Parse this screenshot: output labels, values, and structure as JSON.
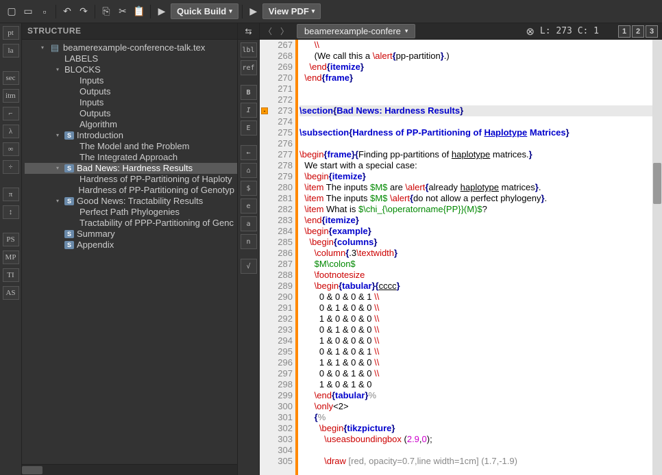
{
  "toolbar": {
    "quick_build": "Quick Build",
    "view_pdf": "View PDF"
  },
  "left_gutter": [
    "pt",
    "la",
    "sec",
    "itm",
    "⌐",
    "λ",
    "∞",
    "÷",
    "π",
    "↕",
    "PS",
    "MP",
    "TI",
    "AS"
  ],
  "mid_gutter": [
    "lbl",
    "ref",
    "B",
    "I",
    "E",
    "←",
    "⌂",
    "$",
    "e",
    "a",
    "n",
    "√"
  ],
  "structure": {
    "title": "STRUCTURE",
    "tree": [
      {
        "d": 0,
        "t": "▾",
        "i": "file",
        "l": "beamerexample-conference-talk.tex"
      },
      {
        "d": 1,
        "t": "",
        "i": "",
        "l": "LABELS"
      },
      {
        "d": 1,
        "t": "▾",
        "i": "",
        "l": "BLOCKS"
      },
      {
        "d": 2,
        "t": "",
        "i": "",
        "l": "Inputs"
      },
      {
        "d": 2,
        "t": "",
        "i": "",
        "l": "Outputs"
      },
      {
        "d": 2,
        "t": "",
        "i": "",
        "l": "Inputs"
      },
      {
        "d": 2,
        "t": "",
        "i": "",
        "l": "Outputs"
      },
      {
        "d": 2,
        "t": "",
        "i": "",
        "l": "Algorithm"
      },
      {
        "d": 1,
        "t": "▾",
        "i": "s",
        "l": "Introduction"
      },
      {
        "d": 2,
        "t": "",
        "i": "",
        "l": "The Model and the Problem"
      },
      {
        "d": 2,
        "t": "",
        "i": "",
        "l": "The Integrated Approach"
      },
      {
        "d": 1,
        "t": "▾",
        "i": "s",
        "l": "Bad News: Hardness Results",
        "sel": true
      },
      {
        "d": 2,
        "t": "",
        "i": "",
        "l": "Hardness of PP-Partitioning of Haploty"
      },
      {
        "d": 2,
        "t": "",
        "i": "",
        "l": "Hardness of PP-Partitioning of Genotyp"
      },
      {
        "d": 1,
        "t": "▾",
        "i": "s",
        "l": "Good News: Tractability Results"
      },
      {
        "d": 2,
        "t": "",
        "i": "",
        "l": "Perfect Path Phylogenies"
      },
      {
        "d": 2,
        "t": "",
        "i": "",
        "l": "Tractability of PPP-Partitioning of Genc"
      },
      {
        "d": 1,
        "t": "",
        "i": "s",
        "l": "Summary"
      },
      {
        "d": 1,
        "t": "",
        "i": "s",
        "l": "Appendix"
      }
    ]
  },
  "editor": {
    "tab": "beamerexample-confere",
    "pos": "L: 273 C: 1",
    "squares": [
      "1",
      "2",
      "3"
    ],
    "first_line": 267,
    "fold_at": 273,
    "highlight": 273,
    "lines": [
      [
        [
          "      ",
          "p"
        ],
        [
          "\\\\",
          "cmd"
        ]
      ],
      [
        [
          "      (We call this a ",
          "p"
        ],
        [
          "\\alert",
          "cmd"
        ],
        [
          "{",
          "br"
        ],
        [
          "pp-partition",
          "p"
        ],
        [
          "}",
          "br"
        ],
        [
          ".)",
          "p"
        ]
      ],
      [
        [
          "    ",
          "p"
        ],
        [
          "\\end",
          "cmd"
        ],
        [
          "{",
          "br"
        ],
        [
          "itemize",
          "sec"
        ],
        [
          "}",
          "br"
        ]
      ],
      [
        [
          "  ",
          "p"
        ],
        [
          "\\end",
          "cmd"
        ],
        [
          "{",
          "br"
        ],
        [
          "frame",
          "sec"
        ],
        [
          "}",
          "br"
        ]
      ],
      [
        [
          "",
          "p"
        ]
      ],
      [
        [
          "",
          "p"
        ]
      ],
      [
        [
          "\\section",
          "sec"
        ],
        [
          "{",
          "br"
        ],
        [
          "Bad News: Hardness Results",
          "sec"
        ],
        [
          "}",
          "br"
        ]
      ],
      [
        [
          "",
          "p"
        ]
      ],
      [
        [
          "\\subsection",
          "sec"
        ],
        [
          "{",
          "br"
        ],
        [
          "Hardness of PP-Partitioning of ",
          "sec"
        ],
        [
          "Haplotype",
          "secu"
        ],
        [
          " Matrices",
          "sec"
        ],
        [
          "}",
          "br"
        ]
      ],
      [
        [
          "",
          "p"
        ]
      ],
      [
        [
          "\\begin",
          "cmd"
        ],
        [
          "{",
          "br"
        ],
        [
          "frame",
          "sec"
        ],
        [
          "}{",
          "br"
        ],
        [
          "Finding pp-partitions of ",
          "p"
        ],
        [
          "haplotype",
          "u"
        ],
        [
          " matrices.",
          "p"
        ],
        [
          "}",
          "br"
        ]
      ],
      [
        [
          "  We start with a special case:",
          "p"
        ]
      ],
      [
        [
          "  ",
          "p"
        ],
        [
          "\\begin",
          "cmd"
        ],
        [
          "{",
          "br"
        ],
        [
          "itemize",
          "sec"
        ],
        [
          "}",
          "br"
        ]
      ],
      [
        [
          "  ",
          "p"
        ],
        [
          "\\item",
          "cmd"
        ],
        [
          " The inputs ",
          "p"
        ],
        [
          "$M$",
          "m"
        ],
        [
          " are ",
          "p"
        ],
        [
          "\\alert",
          "cmd"
        ],
        [
          "{",
          "br"
        ],
        [
          "already ",
          "p"
        ],
        [
          "haplotype",
          "u"
        ],
        [
          " matrices",
          "p"
        ],
        [
          "}",
          "br"
        ],
        [
          ".",
          "p"
        ]
      ],
      [
        [
          "  ",
          "p"
        ],
        [
          "\\item",
          "cmd"
        ],
        [
          " The inputs ",
          "p"
        ],
        [
          "$M$",
          "m"
        ],
        [
          " ",
          "p"
        ],
        [
          "\\alert",
          "cmd"
        ],
        [
          "{",
          "br"
        ],
        [
          "do not allow a perfect phylogeny",
          "p"
        ],
        [
          "}",
          "br"
        ],
        [
          ".",
          "p"
        ]
      ],
      [
        [
          "  ",
          "p"
        ],
        [
          "\\item",
          "cmd"
        ],
        [
          " What is ",
          "p"
        ],
        [
          "$\\chi_{\\operatorname{PP}}(M)$",
          "m"
        ],
        [
          "?",
          "p"
        ]
      ],
      [
        [
          "  ",
          "p"
        ],
        [
          "\\end",
          "cmd"
        ],
        [
          "{",
          "br"
        ],
        [
          "itemize",
          "sec"
        ],
        [
          "}",
          "br"
        ]
      ],
      [
        [
          "  ",
          "p"
        ],
        [
          "\\begin",
          "cmd"
        ],
        [
          "{",
          "br"
        ],
        [
          "example",
          "sec"
        ],
        [
          "}",
          "br"
        ]
      ],
      [
        [
          "    ",
          "p"
        ],
        [
          "\\begin",
          "cmd"
        ],
        [
          "{",
          "br"
        ],
        [
          "columns",
          "sec"
        ],
        [
          "}",
          "br"
        ]
      ],
      [
        [
          "      ",
          "p"
        ],
        [
          "\\column",
          "cmd"
        ],
        [
          "{",
          "br"
        ],
        [
          ".3",
          "p"
        ],
        [
          "\\textwidth",
          "cmd"
        ],
        [
          "}",
          "br"
        ]
      ],
      [
        [
          "      ",
          "p"
        ],
        [
          "$M\\colon$",
          "m"
        ]
      ],
      [
        [
          "      ",
          "p"
        ],
        [
          "\\footnotesize",
          "cmd"
        ]
      ],
      [
        [
          "      ",
          "p"
        ],
        [
          "\\begin",
          "cmd"
        ],
        [
          "{",
          "br"
        ],
        [
          "tabular",
          "sec"
        ],
        [
          "}{",
          "br"
        ],
        [
          "cccc",
          "u"
        ],
        [
          "}",
          "br"
        ]
      ],
      [
        [
          "        0 & 0 & 0 & 1 ",
          "p"
        ],
        [
          "\\\\",
          "cmd"
        ]
      ],
      [
        [
          "        0 & 1 & 0 & 0 ",
          "p"
        ],
        [
          "\\\\",
          "cmd"
        ]
      ],
      [
        [
          "        1 & 0 & 0 & 0 ",
          "p"
        ],
        [
          "\\\\",
          "cmd"
        ]
      ],
      [
        [
          "        0 & 1 & 0 & 0 ",
          "p"
        ],
        [
          "\\\\",
          "cmd"
        ]
      ],
      [
        [
          "        1 & 0 & 0 & 0 ",
          "p"
        ],
        [
          "\\\\",
          "cmd"
        ]
      ],
      [
        [
          "        0 & 1 & 0 & 1 ",
          "p"
        ],
        [
          "\\\\",
          "cmd"
        ]
      ],
      [
        [
          "        1 & 1 & 0 & 0 ",
          "p"
        ],
        [
          "\\\\",
          "cmd"
        ]
      ],
      [
        [
          "        0 & 0 & 1 & 0 ",
          "p"
        ],
        [
          "\\\\",
          "cmd"
        ]
      ],
      [
        [
          "        1 & 0 & 1 & 0",
          "p"
        ]
      ],
      [
        [
          "      ",
          "p"
        ],
        [
          "\\end",
          "cmd"
        ],
        [
          "{",
          "br"
        ],
        [
          "tabular",
          "sec"
        ],
        [
          "}",
          "br"
        ],
        [
          "%",
          "c"
        ]
      ],
      [
        [
          "      ",
          "p"
        ],
        [
          "\\only",
          "cmd"
        ],
        [
          "<2>",
          "p"
        ]
      ],
      [
        [
          "      ",
          "p"
        ],
        [
          "{",
          "br"
        ],
        [
          "%",
          "c"
        ]
      ],
      [
        [
          "        ",
          "p"
        ],
        [
          "\\begin",
          "cmd"
        ],
        [
          "{",
          "br"
        ],
        [
          "tikzpicture",
          "sec"
        ],
        [
          "}",
          "br"
        ]
      ],
      [
        [
          "          ",
          "p"
        ],
        [
          "\\useasboundingbox",
          "cmd"
        ],
        [
          " (",
          "p"
        ],
        [
          "2.9",
          "n"
        ],
        [
          ",",
          "p"
        ],
        [
          "0",
          "n"
        ],
        [
          ");",
          "p"
        ]
      ],
      [
        [
          "",
          "p"
        ]
      ],
      [
        [
          "          ",
          "p"
        ],
        [
          "\\draw",
          "cmd"
        ],
        [
          " [red, opacity=0.7,line width=1cm] (1.7,-1.9)",
          "c"
        ]
      ]
    ]
  }
}
